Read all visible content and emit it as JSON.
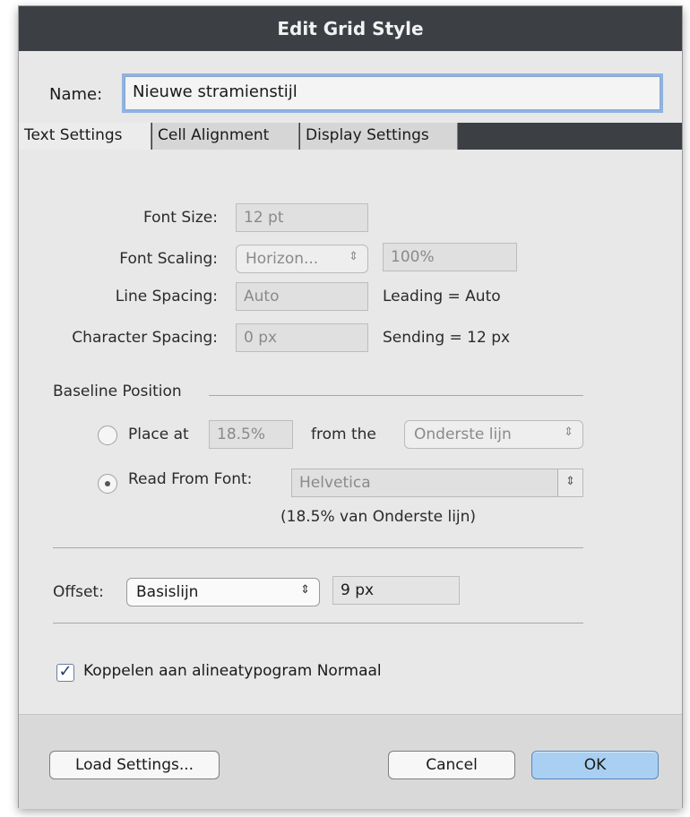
{
  "window": {
    "title": "Edit Grid Style"
  },
  "name": {
    "label": "Name:",
    "value": "Nieuwe stramienstijl"
  },
  "tabs": [
    {
      "label": "Text Settings",
      "active": true
    },
    {
      "label": "Cell Alignment",
      "active": false
    },
    {
      "label": "Display Settings",
      "active": false
    }
  ],
  "text_settings": {
    "font_size": {
      "label": "Font Size:",
      "value": "12 pt"
    },
    "font_scaling": {
      "label": "Font Scaling:",
      "mode": "Horizon...",
      "value": "100%"
    },
    "line_spacing": {
      "label": "Line Spacing:",
      "value": "Auto",
      "note": "Leading = Auto"
    },
    "character_spacing": {
      "label": "Character Spacing:",
      "value": "0 px",
      "note": "Sending = 12 px"
    }
  },
  "baseline": {
    "section_label": "Baseline Position",
    "place_at": {
      "label": "Place at",
      "value": "18.5%",
      "from_label": "from the",
      "from_value": "Onderste lijn",
      "selected": false
    },
    "read_from_font": {
      "label": "Read From Font:",
      "font": "Helvetica",
      "selected": true,
      "note": "(18.5% van Onderste lijn)"
    }
  },
  "offset": {
    "label": "Offset:",
    "mode": "Basislijn",
    "value": "9 px"
  },
  "link": {
    "label": "Koppelen aan alineatypogram Normaal",
    "checked": true
  },
  "buttons": {
    "load": "Load Settings...",
    "cancel": "Cancel",
    "ok": "OK"
  },
  "colors": {
    "titlebar": "#3c3f44",
    "focus_ring": "#8fb3e3",
    "default_button": "#a9d0f2"
  },
  "icons": {
    "popup_arrows": "updown-arrows-icon",
    "check": "checkmark-icon"
  }
}
